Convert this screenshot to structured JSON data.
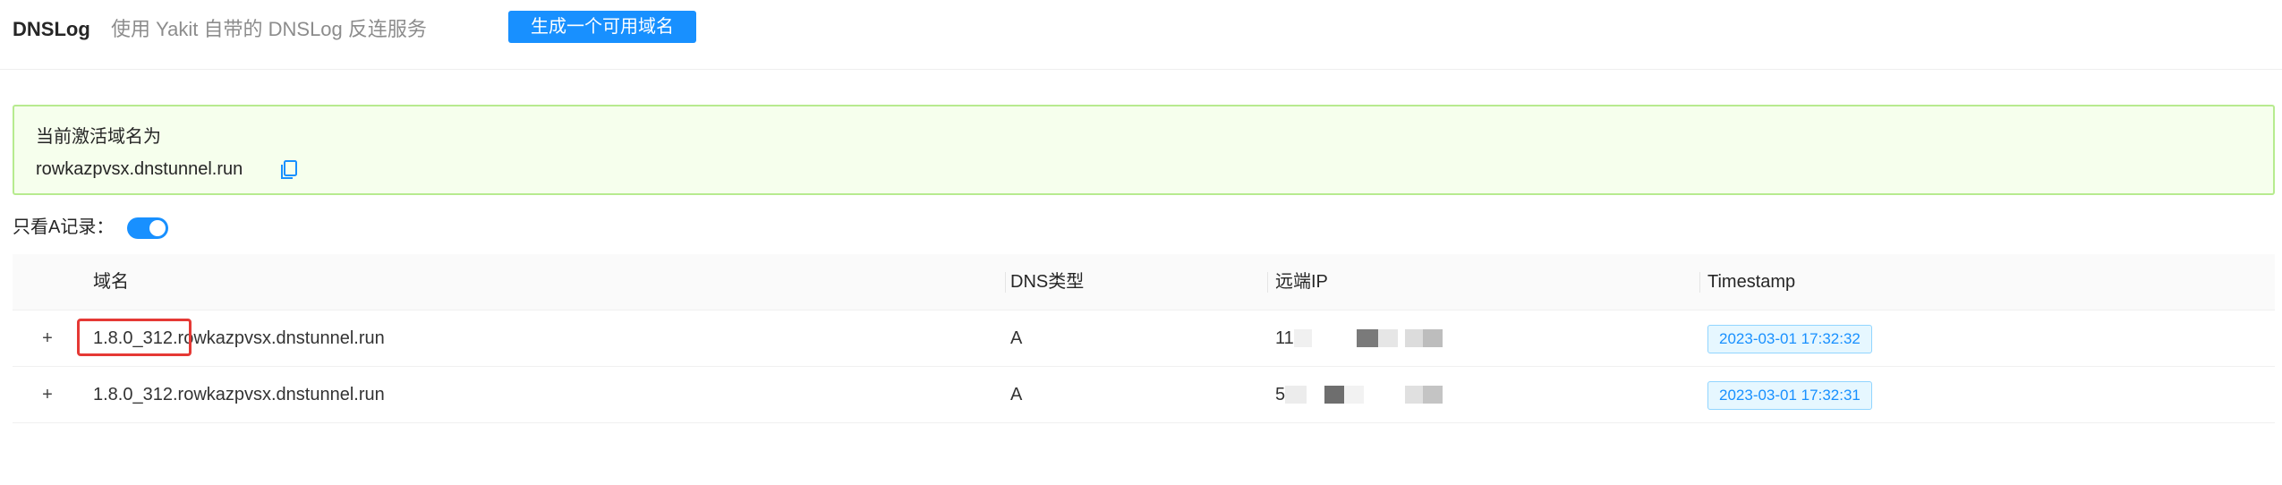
{
  "header": {
    "title": "DNSLog",
    "subtitle": "使用 Yakit 自带的 DNSLog 反连服务",
    "generate_button": "生成一个可用域名"
  },
  "alert": {
    "title": "当前激活域名为",
    "domain": "rowkazpvsx.dnstunnel.run"
  },
  "filter": {
    "label": "只看A记录：",
    "enabled": true
  },
  "table": {
    "columns": [
      "域名",
      "DNS类型",
      "远端IP",
      "Timestamp"
    ],
    "rows": [
      {
        "expand": "+",
        "domain": "1.8.0_312.rowkazpvsx.dnstunnel.run",
        "type": "A",
        "ip_prefix": "11",
        "timestamp": "2023-03-01 17:32:32"
      },
      {
        "expand": "+",
        "domain": "1.8.0_312.rowkazpvsx.dnstunnel.run",
        "type": "A",
        "ip_prefix": "5",
        "timestamp": "2023-03-01 17:32:31"
      }
    ]
  },
  "colors": {
    "accent": "#1890ff",
    "success_bg": "#f6ffed",
    "success_border": "#b7eb8f",
    "highlight": "#e53935"
  }
}
